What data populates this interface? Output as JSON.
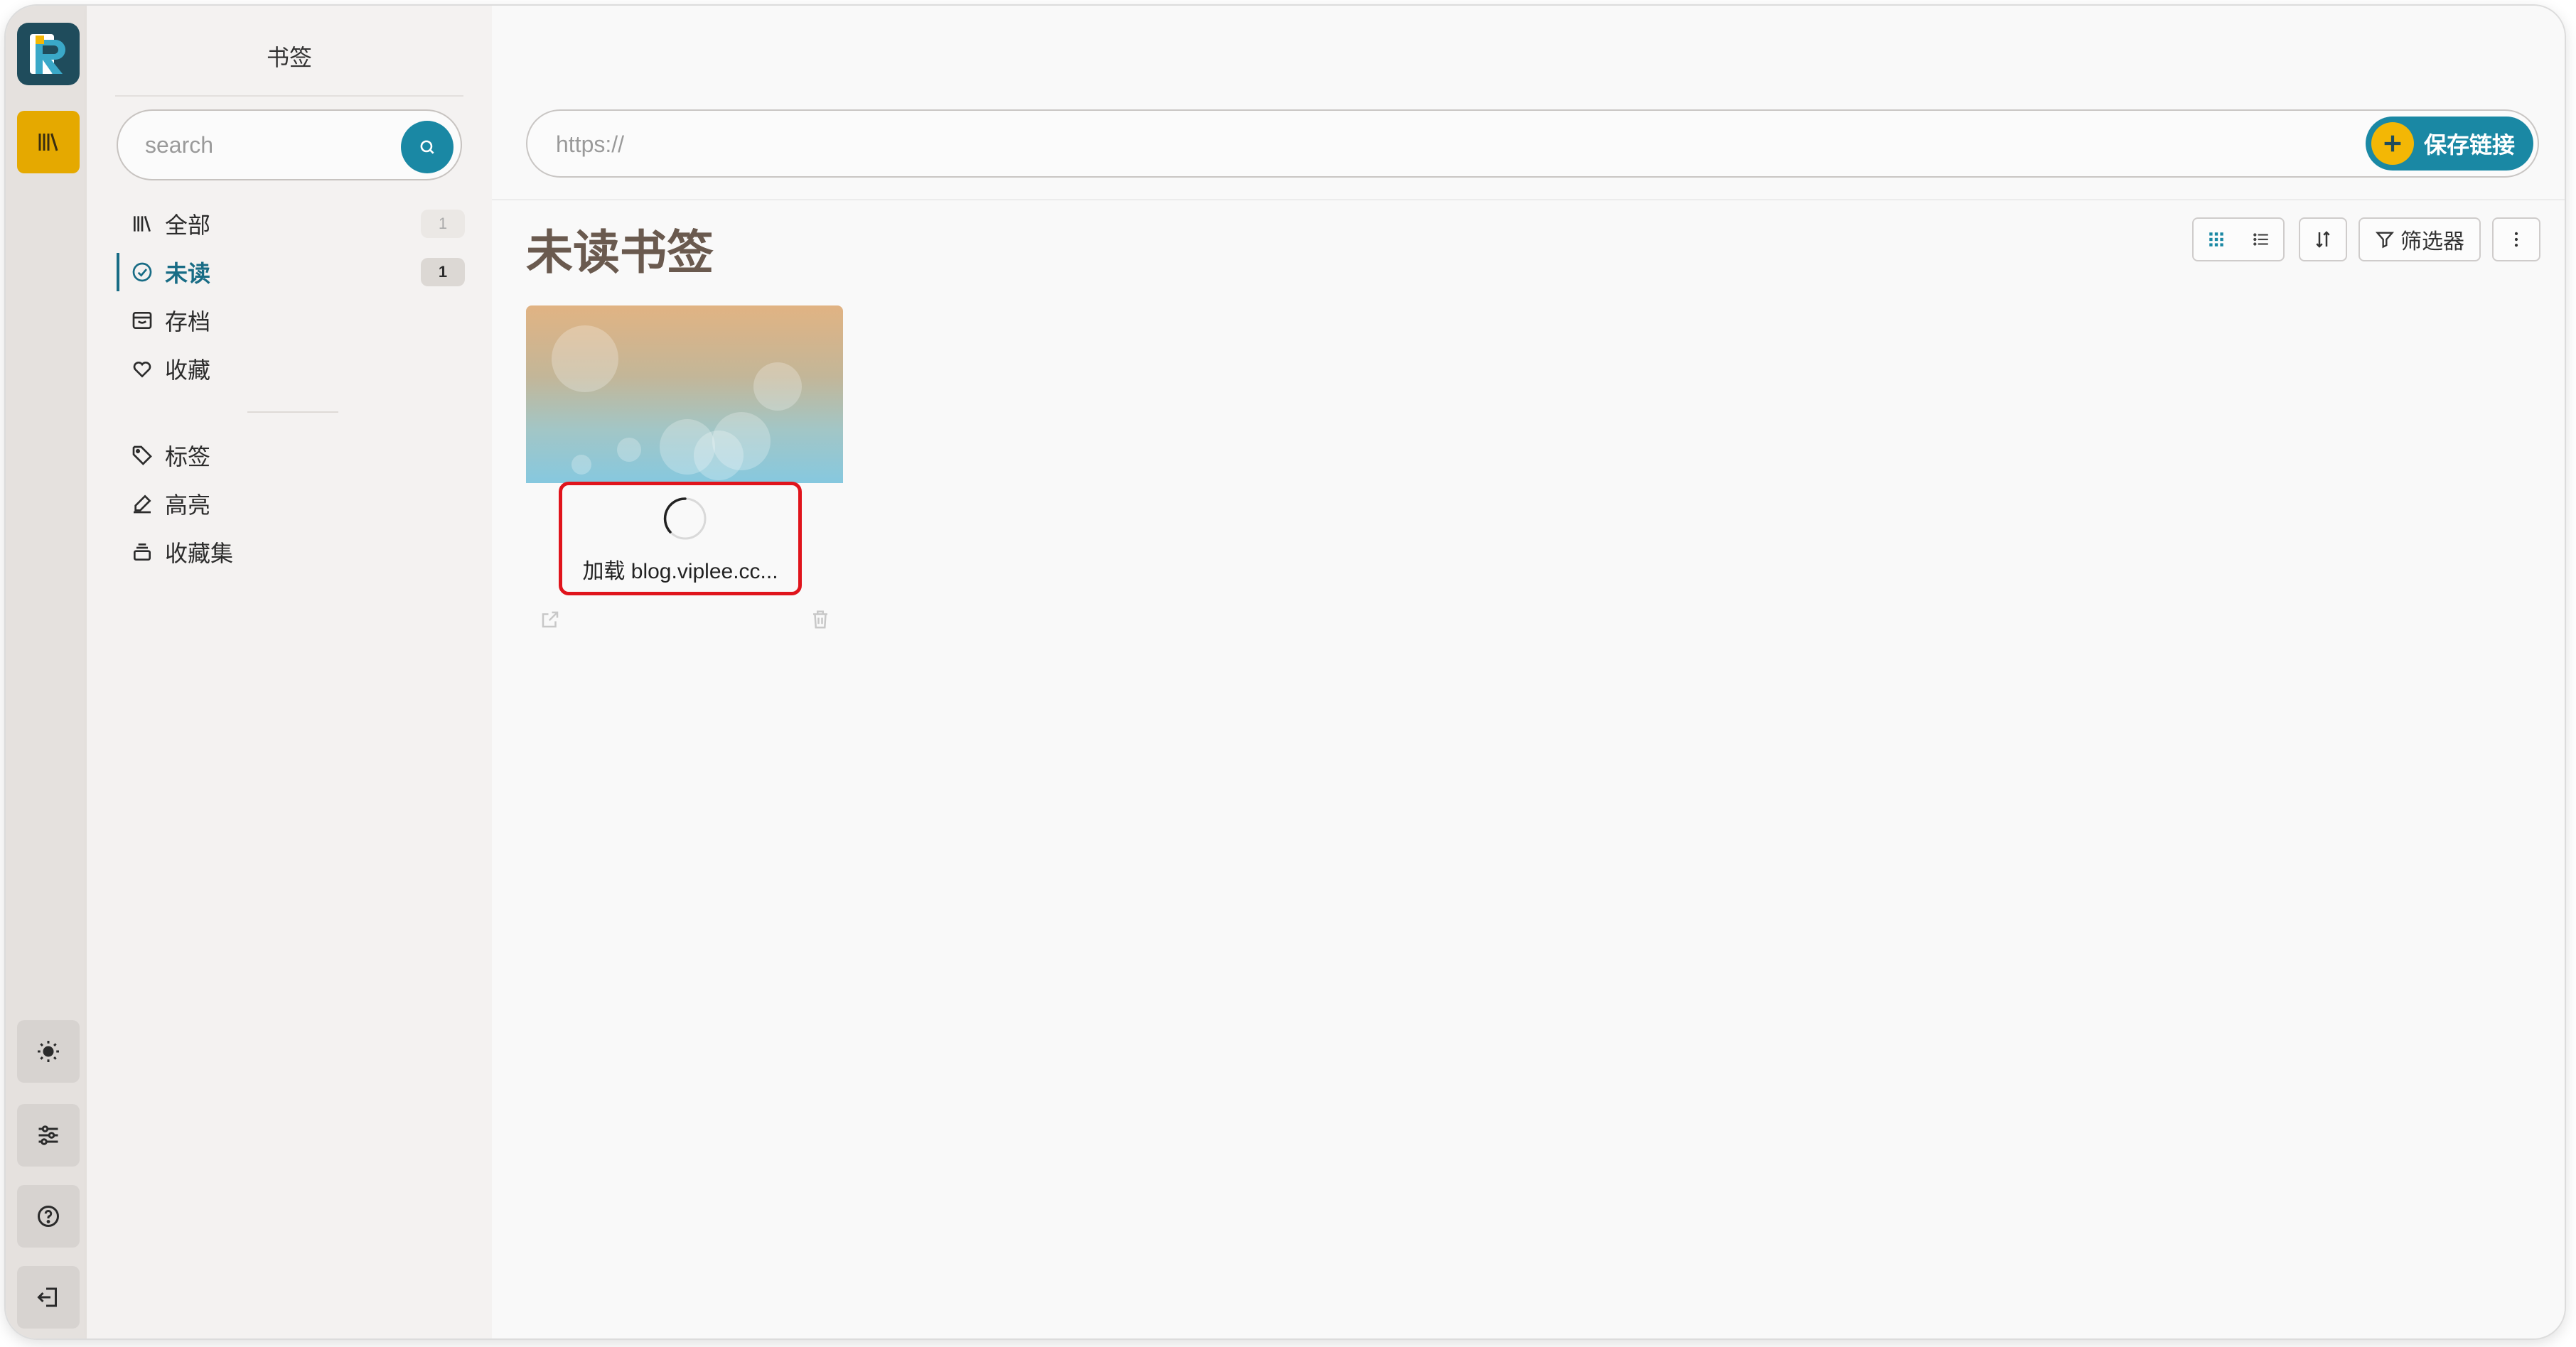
{
  "sidebar": {
    "title": "书签",
    "search_placeholder": "search",
    "items": [
      {
        "label": "全部",
        "count": "1",
        "icon": "library-icon"
      },
      {
        "label": "未读",
        "count": "1",
        "icon": "check-circle-icon",
        "active": true
      },
      {
        "label": "存档",
        "icon": "archive-box-icon"
      },
      {
        "label": "收藏",
        "icon": "heart-icon"
      },
      {
        "label": "标签",
        "icon": "tag-icon"
      },
      {
        "label": "高亮",
        "icon": "highlighter-icon"
      },
      {
        "label": "收藏集",
        "icon": "collections-icon"
      }
    ]
  },
  "rail": {
    "icons": [
      "reader-logo-icon",
      "library-icon",
      "sun-icon",
      "sliders-icon",
      "help-icon",
      "logout-icon"
    ]
  },
  "url_bar": {
    "placeholder": "https://",
    "save_label": "保存链接"
  },
  "main": {
    "title": "未读书签",
    "filter_label": "筛选器"
  },
  "card": {
    "loading_text": "加载 blog.viplee.cc..."
  },
  "colors": {
    "accent": "#1a88a4",
    "rail_active": "#e5a900",
    "highlight_box": "#e0141c",
    "title": "#6a5a4f"
  }
}
